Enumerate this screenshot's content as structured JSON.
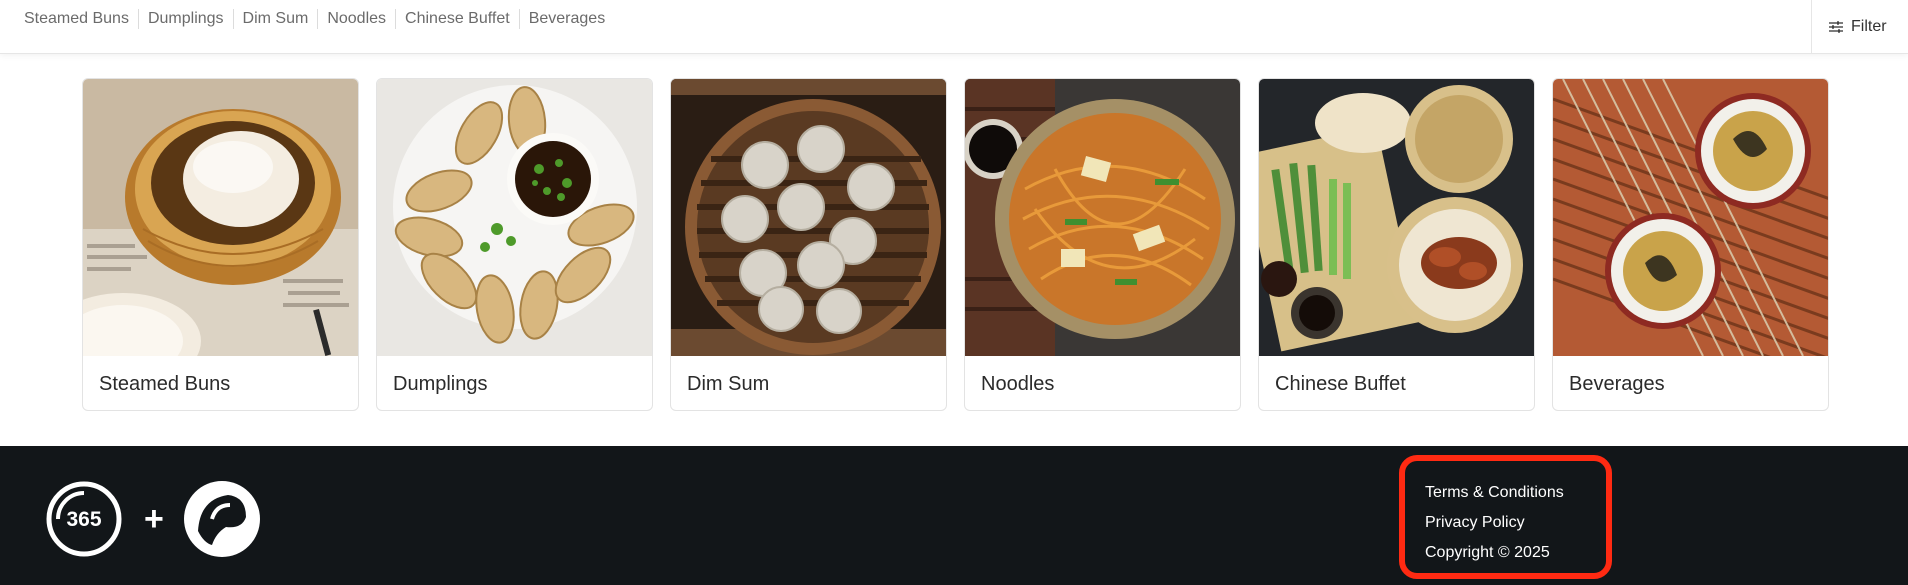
{
  "nav": {
    "categories": [
      "Steamed Buns",
      "Dumplings",
      "Dim Sum",
      "Noodles",
      "Chinese Buffet",
      "Beverages"
    ],
    "filter_label": "Filter"
  },
  "cards": [
    {
      "label": "Steamed Buns"
    },
    {
      "label": "Dumplings"
    },
    {
      "label": "Dim Sum"
    },
    {
      "label": "Noodles"
    },
    {
      "label": "Chinese Buffet"
    },
    {
      "label": "Beverages"
    }
  ],
  "footer": {
    "logo_left_text": "365",
    "plus": "+",
    "terms_label": "Terms & Conditions",
    "privacy_label": "Privacy Policy",
    "copyright": "Copyright © 2025"
  },
  "colors": {
    "footer_bg": "#121619",
    "highlight": "#ff2a12"
  }
}
